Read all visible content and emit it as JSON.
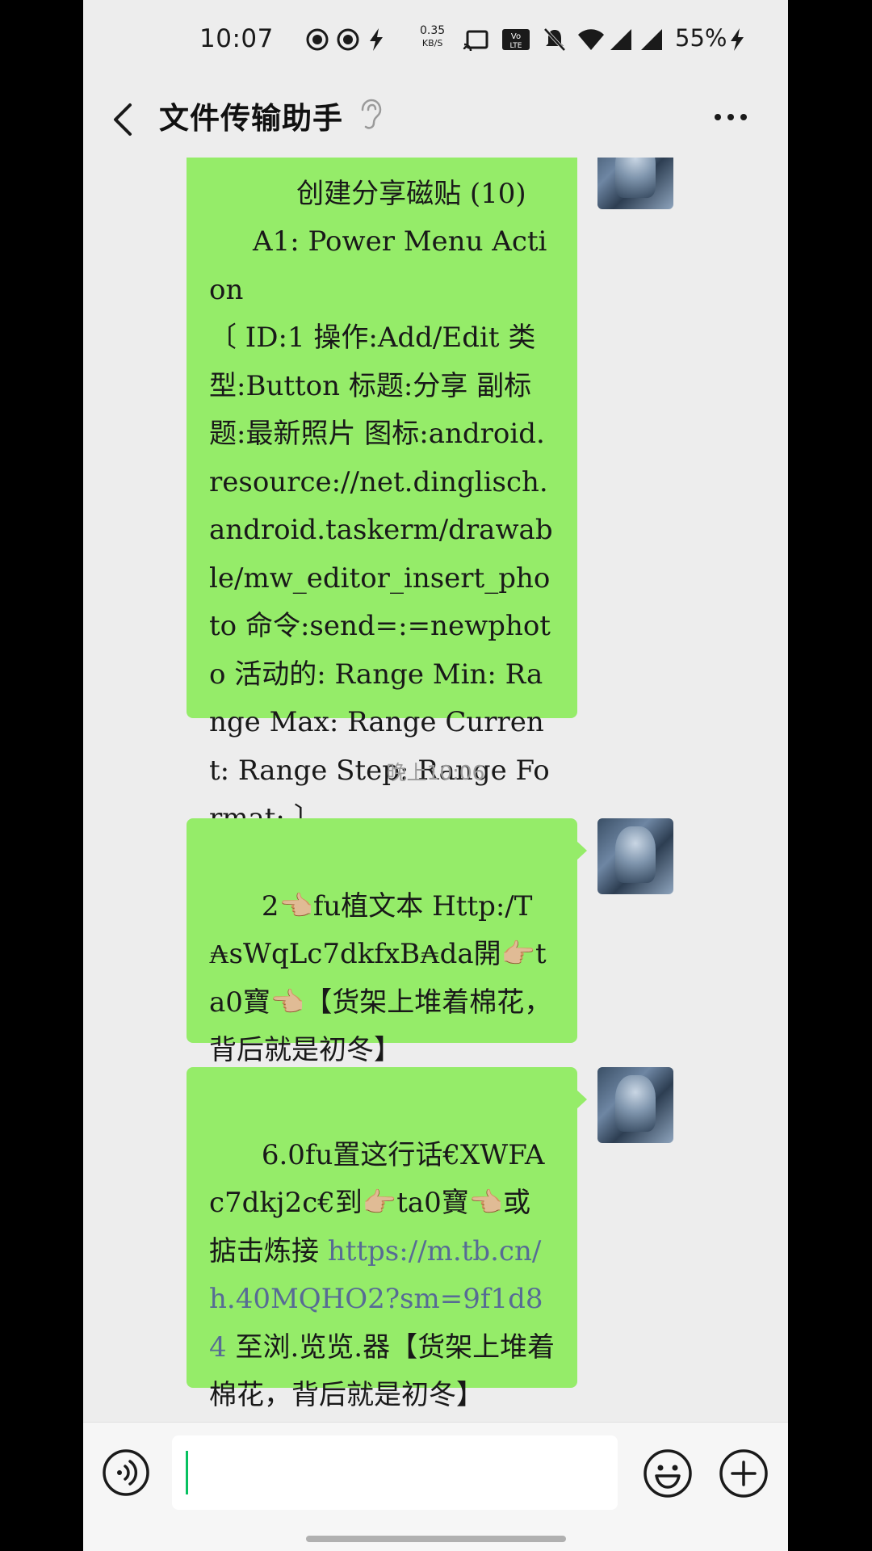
{
  "status_bar": {
    "time": "10:07",
    "net_speed_value": "0.35",
    "net_speed_unit": "KB/S",
    "battery": "55%"
  },
  "header": {
    "title": "文件传输助手"
  },
  "messages": [
    {
      "text": "    创建分享磁贴 (10)\n     A1: Power Menu Action\n〔 ID:1 操作:Add/Edit 类型:Button 标题:分享 副标题:最新照片 图标:android.resource://net.dinglisch.android.taskerm/drawable/mw_editor_insert_photo 命令:send=:=newphoto 活动的: Range Min: Range Max: Range Current: Range Step: Range Format: 〕"
    },
    {
      "text": "2👈🏼fu植文本 Http:/T₳sWqLc7dkfxB₳da開👉🏼ta0寶👈🏼【货架上堆着棉花，背后就是初冬】"
    },
    {
      "text_before_link": "6.0fu置这行话€XWFAc7dkj2c€到👉🏼ta0寶👈🏼或掂击炼接 ",
      "link": "https://m.tb.cn/h.40MQHO2?sm=9f1d84",
      "text_after_link": " 至浏.览览.器【货架上堆着棉花，背后就是初冬】"
    }
  ],
  "timestamp": "晚上10:06",
  "input": {
    "value": ""
  }
}
